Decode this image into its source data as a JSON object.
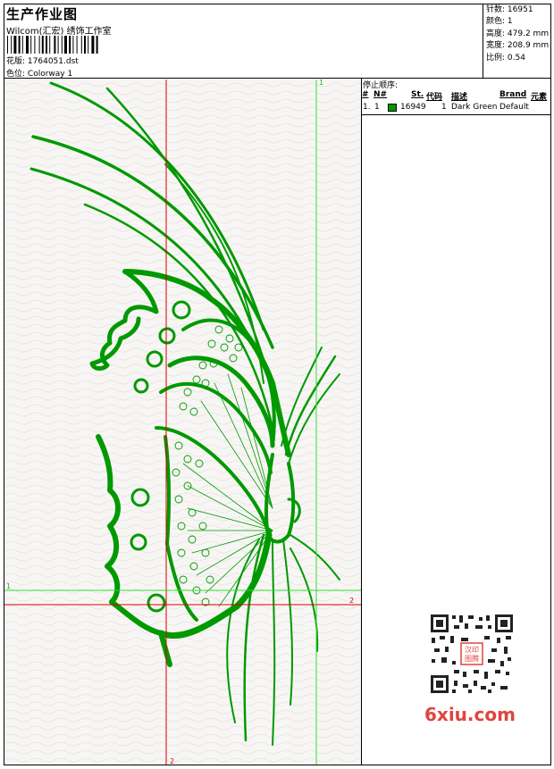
{
  "header": {
    "title": "生产作业图",
    "studio": "Wilcom(汇宏) 绣饰工作室",
    "design_file_label": "花版:",
    "design_file": "1764051.dst",
    "colorway_label": "色位:",
    "colorway": "Colorway 1"
  },
  "stats": {
    "stitches_label": "针数:",
    "stitches": "16951",
    "colors_label": "颜色:",
    "colors": "1",
    "height_label": "高度:",
    "height": "479.2 mm",
    "width_label": "宽度:",
    "width": "208.9 mm",
    "scale_label": "比例:",
    "scale": "0.54"
  },
  "stop_sequence": {
    "title": "停止顺序:",
    "columns": [
      "#",
      "N#",
      "St.",
      "代码",
      "描述",
      "Brand",
      "元素"
    ],
    "rows": [
      {
        "num": "1.",
        "needle": "1",
        "code": "16949",
        "stitches": "1",
        "description": "Dark Green",
        "brand": "Default",
        "color": "#009900"
      }
    ]
  },
  "canvas": {
    "guide_labels": [
      "1",
      "1",
      "2",
      "2"
    ],
    "guide_colors": {
      "red": "#e00000",
      "green": "#33dd33"
    },
    "thread_color": "#009900"
  },
  "watermark": {
    "stamp_text": "汉印图腾",
    "brand": "6xiu.com"
  }
}
